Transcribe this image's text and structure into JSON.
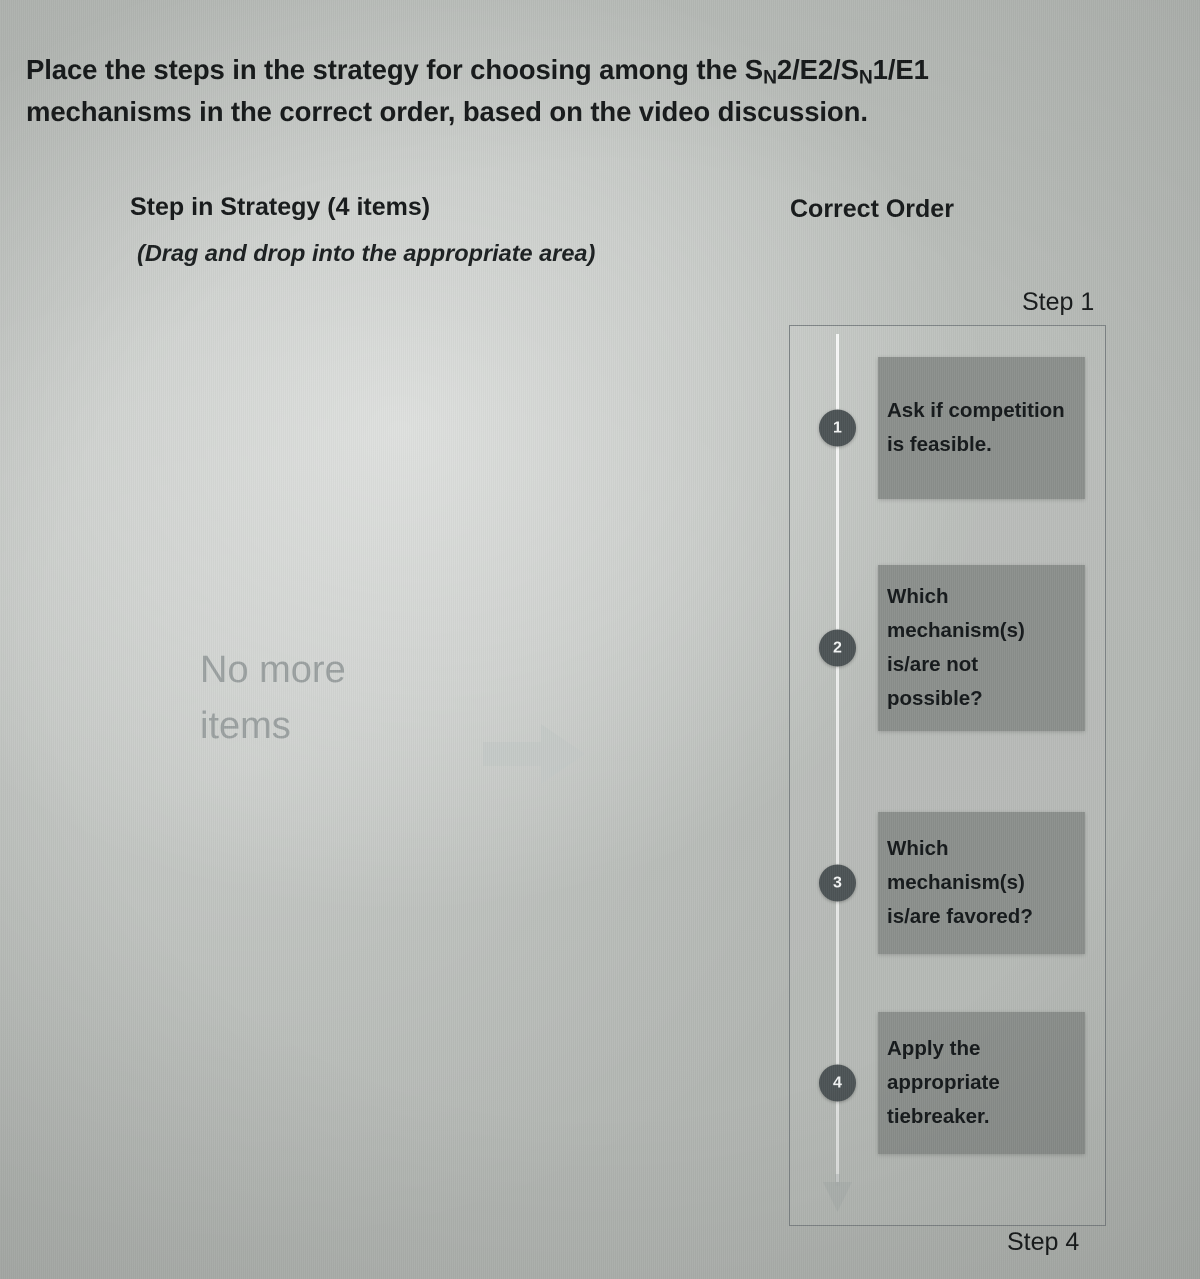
{
  "prompt": {
    "line1_before": "Place the steps in the strategy for choosing among the S",
    "line1_sub1": "N",
    "line1_mid": "2/E2/S",
    "line1_sub2": "N",
    "line1_after": "1/E1",
    "line2": "mechanisms in the correct order, based on the video discussion."
  },
  "columns": {
    "left_heading": "Step in Strategy (4 items)",
    "left_subheading": "(Drag and drop into the appropriate area)",
    "right_heading": "Correct Order"
  },
  "source_bank": {
    "empty_message": "No more items",
    "arrow_icon": "arrow-right-icon"
  },
  "drop_zone": {
    "top_label": "Step 1",
    "bottom_label": "Step 4",
    "track_arrow_icon": "arrow-down-icon",
    "slots": [
      {
        "number": "1",
        "text": "Ask if competition is feasible."
      },
      {
        "number": "2",
        "text": "Which mechanism(s) is/are not possible?"
      },
      {
        "number": "3",
        "text": "Which mechanism(s) is/are favored?"
      },
      {
        "number": "4",
        "text": "Apply the appropriate tiebreaker."
      }
    ]
  },
  "colors": {
    "background": "#b9bdb9",
    "card_fill": "#8b8f8c",
    "badge_fill": "#4c5355",
    "text": "#16191a",
    "empty_text": "#9aa0a0",
    "border": "#7e8486"
  }
}
